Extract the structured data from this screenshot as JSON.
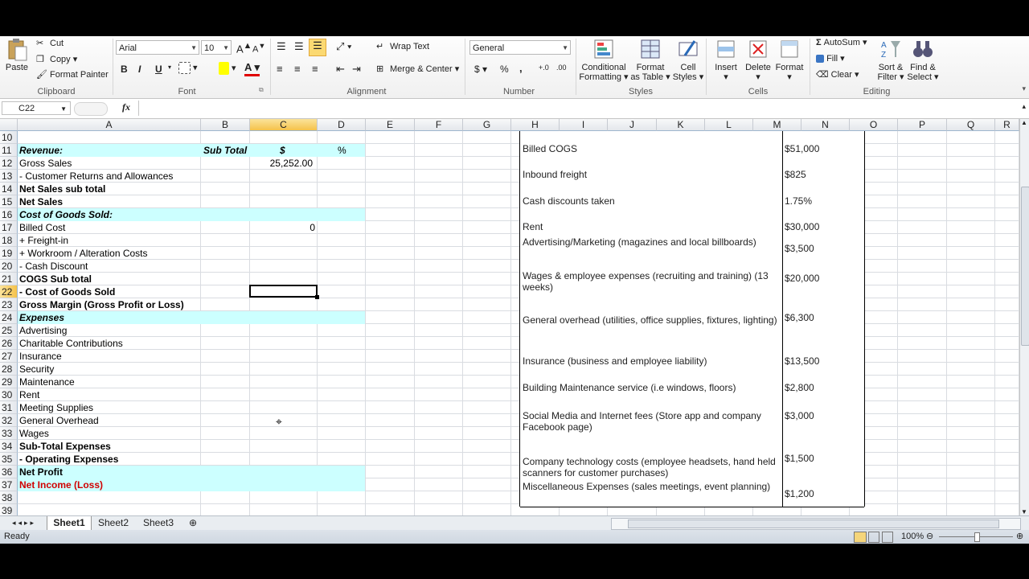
{
  "ribbon": {
    "clipboard": {
      "paste": "Paste",
      "cut": "Cut",
      "copy": "Copy",
      "format_painter": "Format Painter",
      "group": "Clipboard"
    },
    "font": {
      "name": "Arial",
      "size": "10",
      "bold": "B",
      "italic": "I",
      "underline": "U",
      "group": "Font"
    },
    "alignment": {
      "wrap": "Wrap Text",
      "merge": "Merge & Center",
      "group": "Alignment"
    },
    "number": {
      "format": "General",
      "currency": "$",
      "percent": "%",
      "comma": ",",
      "group": "Number"
    },
    "styles": {
      "conditional": "Conditional",
      "conditional2": "Formatting",
      "format_as": "Format",
      "format_as2": "as Table",
      "cell": "Cell",
      "cell2": "Styles",
      "group": "Styles"
    },
    "cells": {
      "insert": "Insert",
      "delete": "Delete",
      "format": "Format",
      "group": "Cells"
    },
    "editing": {
      "autosum": "AutoSum",
      "fill": "Fill",
      "clear": "Clear",
      "sort": "Sort &",
      "sort2": "Filter",
      "find": "Find &",
      "find2": "Select",
      "group": "Editing"
    }
  },
  "formula_bar": {
    "name_box": "C22",
    "fx": "fx",
    "formula": ""
  },
  "columns": [
    "A",
    "B",
    "C",
    "D",
    "E",
    "F",
    "G",
    "H",
    "I",
    "J",
    "K",
    "L",
    "M",
    "N",
    "O",
    "P",
    "Q",
    "R"
  ],
  "rows": [
    "10",
    "11",
    "12",
    "13",
    "14",
    "15",
    "16",
    "17",
    "18",
    "19",
    "20",
    "21",
    "22",
    "23",
    "24",
    "25",
    "26",
    "27",
    "28",
    "29",
    "30",
    "31",
    "32",
    "33",
    "34",
    "35",
    "36",
    "37",
    "38",
    "39"
  ],
  "selected_cell": "C22",
  "sheet": {
    "r11": {
      "a": "Revenue:",
      "b": "Sub Total",
      "c": "$",
      "d": "%"
    },
    "r12": {
      "a": "Gross Sales",
      "c": "25,252.00"
    },
    "r13": {
      "a": "- Customer Returns and Allowances"
    },
    "r14": {
      "a": "Net Sales sub total"
    },
    "r15": {
      "a": "Net Sales"
    },
    "r16": {
      "a": "Cost of Goods Sold:"
    },
    "r17": {
      "a": "Billed Cost",
      "c": "0"
    },
    "r18": {
      "a": "+ Freight-in"
    },
    "r19": {
      "a": "+ Workroom / Alteration Costs"
    },
    "r20": {
      "a": "- Cash Discount"
    },
    "r21": {
      "a": "COGS Sub total"
    },
    "r22": {
      "a": "- Cost of Goods Sold"
    },
    "r23": {
      "a": "Gross Margin (Gross Profit or Loss)"
    },
    "r24": {
      "a": "Expenses"
    },
    "r25": {
      "a": "Advertising"
    },
    "r26": {
      "a": "Charitable Contributions"
    },
    "r27": {
      "a": "Insurance"
    },
    "r28": {
      "a": "Security"
    },
    "r29": {
      "a": "Maintenance"
    },
    "r30": {
      "a": "Rent"
    },
    "r31": {
      "a": "Meeting Supplies"
    },
    "r32": {
      "a": "General Overhead"
    },
    "r33": {
      "a": "Wages"
    },
    "r34": {
      "a": "Sub-Total Expenses"
    },
    "r35": {
      "a": "- Operating Expenses"
    },
    "r36": {
      "a": "Net Profit"
    },
    "r37": {
      "a": "Net Income (Loss)"
    }
  },
  "cost_table": [
    {
      "desc": "Billed COGS",
      "value": "$51,000"
    },
    {
      "desc": "Inbound freight",
      "value": "$825"
    },
    {
      "desc": "Cash discounts taken",
      "value": "1.75%"
    },
    {
      "desc": "Rent",
      "value": "$30,000"
    },
    {
      "desc": "Advertising/Marketing (magazines and local billboards)",
      "value": "$3,500"
    },
    {
      "desc": "Wages & employee expenses (recruiting and training) (13 weeks)",
      "value": "$20,000"
    },
    {
      "desc": "General overhead (utilities, office supplies, fixtures, lighting)",
      "value": "$6,300"
    },
    {
      "desc": "Insurance (business and employee liability)",
      "value": "$13,500"
    },
    {
      "desc": "Building Maintenance service (i.e windows, floors)",
      "value": "$2,800"
    },
    {
      "desc": "Social Media and Internet fees (Store app and company Facebook page)",
      "value": "$3,000"
    },
    {
      "desc": "Company technology costs (employee headsets, hand held scanners for customer purchases)",
      "value": "$1,500"
    },
    {
      "desc": "Miscellaneous Expenses (sales meetings, event planning)",
      "value": "$1,200"
    }
  ],
  "tabs": [
    "Sheet1",
    "Sheet2",
    "Sheet3"
  ],
  "status": {
    "ready": "Ready",
    "zoom": "100%"
  },
  "colors": {
    "band": "#ccffff",
    "net_income": "#d00000",
    "selected_header": "#f5c24a"
  }
}
